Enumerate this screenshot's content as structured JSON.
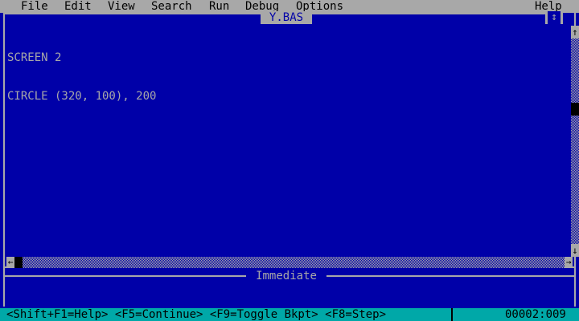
{
  "menu": {
    "items": [
      {
        "label": "File"
      },
      {
        "label": "Edit"
      },
      {
        "label": "View"
      },
      {
        "label": "Search"
      },
      {
        "label": "Run"
      },
      {
        "label": "Debug"
      },
      {
        "label": "Options"
      }
    ],
    "help_label": "Help"
  },
  "editor": {
    "title": "Y.BAS",
    "lines": [
      "SCREEN 2",
      "CIRCLE (320, 100), 200"
    ],
    "maximize_icon": "↕"
  },
  "scrollbars": {
    "up_arrow": "↑",
    "down_arrow": "↓",
    "left_arrow": "←",
    "right_arrow": "→"
  },
  "immediate": {
    "title": "Immediate"
  },
  "statusbar": {
    "hints": "<Shift+F1=Help> <F5=Continue> <F9=Toggle Bkpt> <F8=Step>",
    "position": "00002:009"
  },
  "colors": {
    "background": "#0000a8",
    "menu": "#a8a8a8",
    "status": "#00a8a8"
  }
}
